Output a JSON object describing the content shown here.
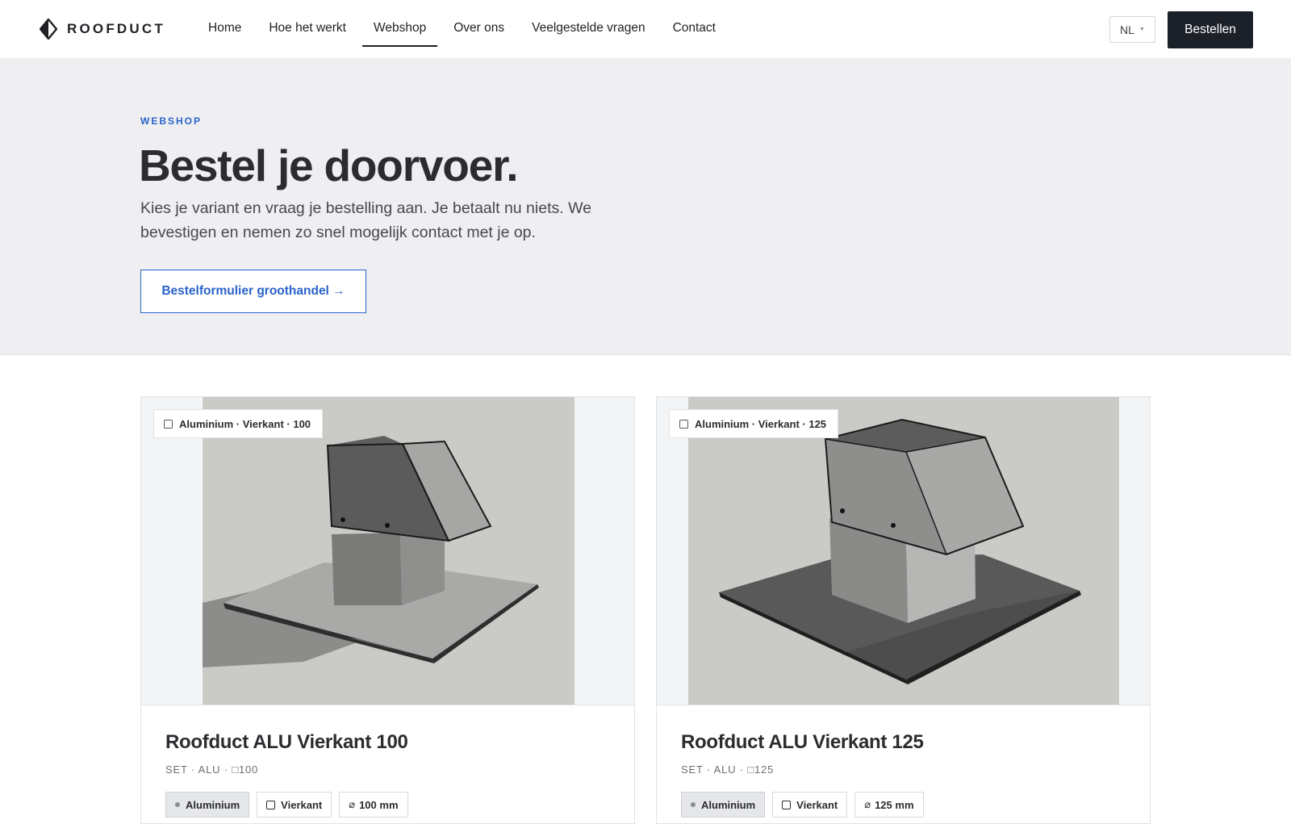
{
  "header": {
    "brand": "ROOFDUCT",
    "nav": [
      {
        "label": "Home",
        "active": false
      },
      {
        "label": "Hoe het werkt",
        "active": false
      },
      {
        "label": "Webshop",
        "active": true
      },
      {
        "label": "Over ons",
        "active": false
      },
      {
        "label": "Veelgestelde vragen",
        "active": false
      },
      {
        "label": "Contact",
        "active": false
      }
    ],
    "language": "NL",
    "order_button": "Bestellen"
  },
  "hero": {
    "eyebrow": "WEBSHOP",
    "title": "Bestel je doorvoer.",
    "text": "Kies je variant en vraag je bestelling aan. Je betaalt nu niets. We bevestigen en nemen zo snel mogelijk contact met je op.",
    "cta": "Bestelformulier groothandel →"
  },
  "products": [
    {
      "badge": "Aluminium · Vierkant · 100",
      "title": "Roofduct ALU Vierkant 100",
      "sku": "SET · ALU · □100",
      "tags": [
        "Aluminium",
        "Vierkant",
        "100 mm"
      ]
    },
    {
      "badge": "Aluminium · Vierkant · 125",
      "title": "Roofduct ALU Vierkant 125",
      "sku": "SET · ALU · □125",
      "tags": [
        "Aluminium",
        "Vierkant",
        "125 mm"
      ]
    }
  ],
  "icons": {
    "logo": "diamond-logo-icon",
    "badge_check": "checkbox-icon",
    "material": "dot-icon",
    "shape": "square-icon",
    "diameter": "diameter-icon"
  },
  "colors": {
    "accent": "#2a63c9",
    "dark_button": "#1c2029",
    "hero_background": "#efeff1"
  }
}
